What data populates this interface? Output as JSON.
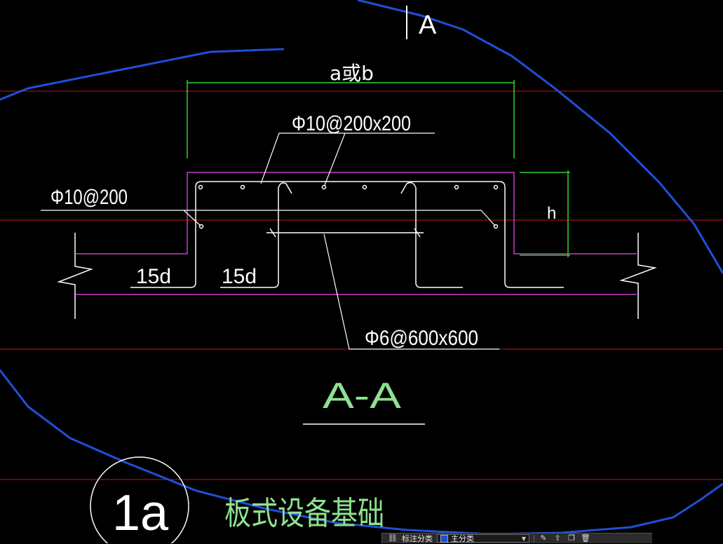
{
  "drawing": {
    "section_marker": "A",
    "dimension_width": "a或b",
    "dimension_height": "h",
    "rebar_top": "Φ10@200x200",
    "rebar_side": "Φ10@200",
    "rebar_bottom": "Φ6@600x600",
    "anchor_left": "15d",
    "anchor_mid": "15d",
    "section_title": "A-A",
    "detail_number": "1a",
    "detail_title": "板式设备基础"
  },
  "status_bar": {
    "label": "标注分类",
    "layer_name": "主分类",
    "icons": [
      "layer-manager-icon",
      "edit-icon",
      "export-icon",
      "copy-icon",
      "delete-icon"
    ]
  },
  "colors": {
    "background": "#000000",
    "grid_red": "#c8141e",
    "cloud_blue": "#1f4fd8",
    "magenta": "#c83cc8",
    "green": "#2fd42f",
    "white": "#ffffff",
    "text_green": "#8fe08f"
  }
}
